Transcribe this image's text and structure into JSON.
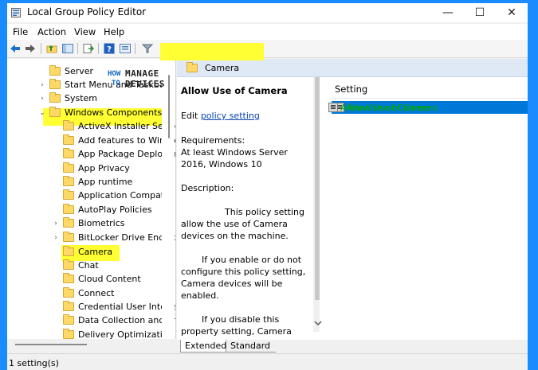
{
  "window": {
    "title": "Local Group Policy Editor",
    "minimize": "—",
    "maximize": "☐",
    "close": "✕"
  },
  "menu": [
    "File",
    "Action",
    "View",
    "Help"
  ],
  "tree": [
    {
      "label": "Server",
      "expandable": false
    },
    {
      "label": "Start Menu and Taskbar",
      "expandable": true,
      "chevron": "›"
    },
    {
      "label": "System",
      "expandable": true,
      "chevron": "›"
    },
    {
      "label": "Windows Components",
      "expandable": true,
      "chevron": "⌄"
    },
    {
      "label": "ActiveX Installer Service",
      "expandable": false
    },
    {
      "label": "Add features to Windows",
      "expandable": false
    },
    {
      "label": "App Package Deployment",
      "expandable": false
    },
    {
      "label": "App Privacy",
      "expandable": false
    },
    {
      "label": "App runtime",
      "expandable": false
    },
    {
      "label": "Application Compatibility",
      "expandable": false
    },
    {
      "label": "AutoPlay Policies",
      "expandable": false
    },
    {
      "label": "Biometrics",
      "expandable": true,
      "chevron": "›"
    },
    {
      "label": "BitLocker Drive Encryption",
      "expandable": true,
      "chevron": "›"
    },
    {
      "label": "Camera",
      "expandable": false
    },
    {
      "label": "Chat",
      "expandable": false
    },
    {
      "label": "Cloud Content",
      "expandable": false
    },
    {
      "label": "Connect",
      "expandable": false
    },
    {
      "label": "Credential User Interface",
      "expandable": false
    },
    {
      "label": "Data Collection and Preview Builds",
      "expandable": false
    },
    {
      "label": "Delivery Optimization",
      "expandable": false
    }
  ],
  "category": {
    "title": "Camera"
  },
  "description": {
    "title": "Allow Use of Camera",
    "edit_prefix": "Edit ",
    "edit_link": "policy setting",
    "requirements": "Requirements:\nAt least Windows Server 2016, Windows 10",
    "description_label": "Description:",
    "para1": "This policy setting allow the use of Camera devices on the machine.",
    "para2": "If you enable or do not configure this policy setting, Camera devices will be enabled.",
    "para3": "If you disable this property setting, Camera devices will be disabled."
  },
  "list": {
    "column_header": "Setting",
    "rows": [
      {
        "label": "Allow Use of Camera"
      }
    ]
  },
  "tabs": {
    "extended": "Extended",
    "standard": "Standard"
  },
  "status": {
    "text": "1 setting(s)"
  },
  "watermark": {
    "how": "HOW",
    "to": "TO",
    "manage": "MANAGE",
    "devices": "DEVICES"
  },
  "colors": {
    "highlight": "#ffff33",
    "selection": "#0078d7",
    "link": "#0645ad",
    "frame": "#1a8cff"
  }
}
